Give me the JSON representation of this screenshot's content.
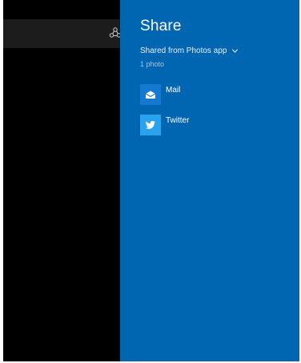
{
  "share_charm": {
    "title": "Share",
    "source_label": "Shared from Photos app",
    "item_count": "1 photo",
    "targets": [
      {
        "label": "Mail",
        "icon": "mail-icon"
      },
      {
        "label": "Twitter",
        "icon": "twitter-icon"
      }
    ]
  },
  "colors": {
    "charm_background": "#0066b2",
    "app_background": "#000000",
    "toolbar_background": "#1c1c1c",
    "mail_tile": "#1679d0",
    "twitter_tile": "#2aa3ef"
  },
  "app": {
    "share_indicator_icon": "share-icon"
  }
}
